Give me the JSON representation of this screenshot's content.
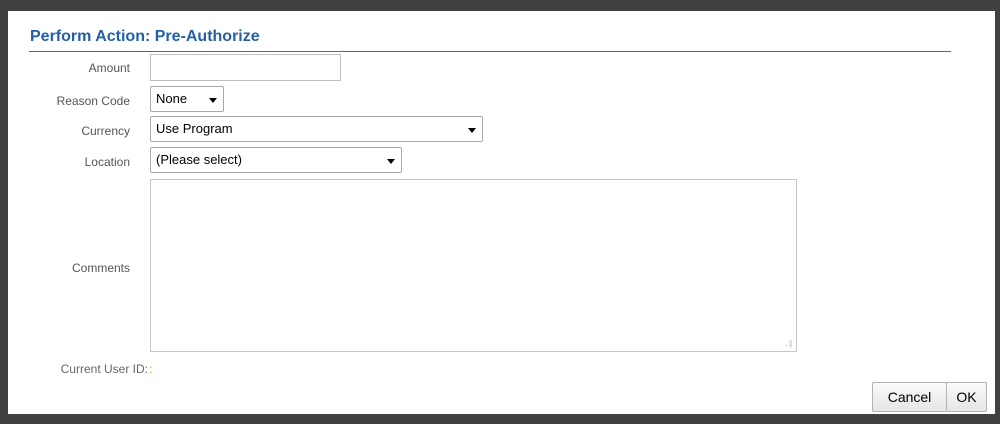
{
  "dialog": {
    "title": "Perform Action: Pre-Authorize"
  },
  "form": {
    "amount": {
      "label": "Amount",
      "value": ""
    },
    "reason_code": {
      "label": "Reason Code",
      "selected": "None"
    },
    "currency": {
      "label": "Currency",
      "selected": "Use Program"
    },
    "location": {
      "label": "Location",
      "selected": "(Please select)"
    },
    "comments": {
      "label": "Comments",
      "value": ""
    },
    "current_user_id": {
      "label": "Current User ID:",
      "value": ":"
    }
  },
  "buttons": {
    "cancel_label": "Cancel",
    "ok_label": "OK"
  },
  "icons": {
    "dropdown": "chevron-down-icon",
    "resize": "resize-grip-icon"
  },
  "colors": {
    "title": "#2560a5",
    "background": "#414141",
    "label": "#555555"
  }
}
